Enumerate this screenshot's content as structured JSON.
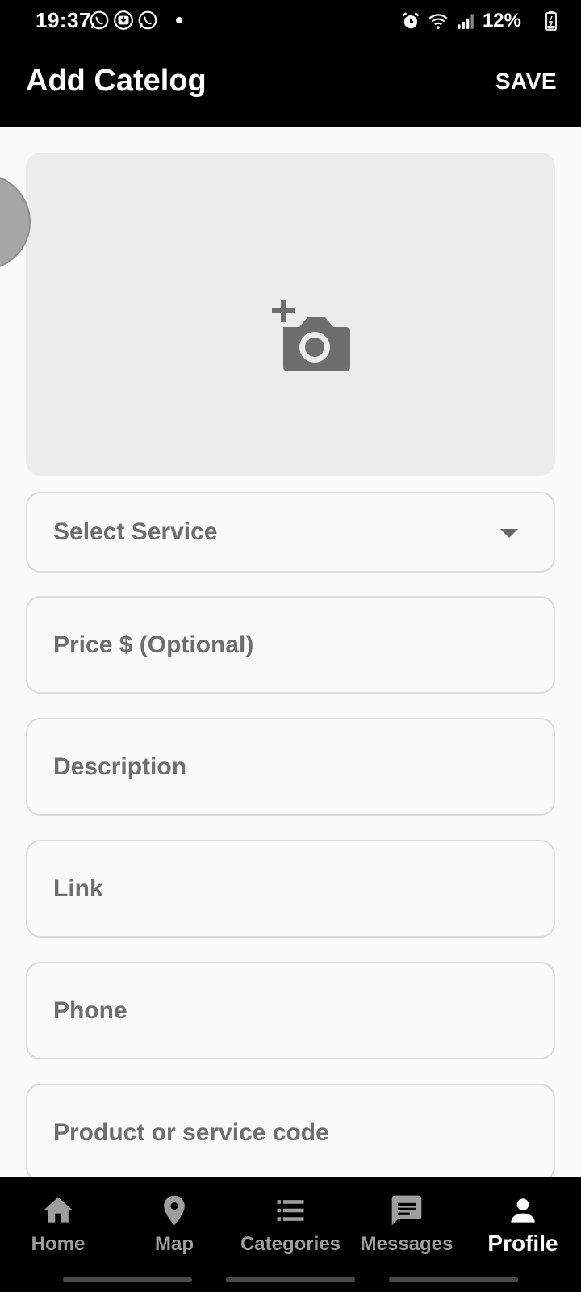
{
  "status_bar": {
    "time": "19:37",
    "battery": "12%",
    "left_icons": [
      "whatsapp-icon",
      "download-icon",
      "whatsapp-icon"
    ],
    "right_icons": [
      "alarm-icon",
      "wifi-icon",
      "signal-icon",
      "battery-icon"
    ]
  },
  "app_bar": {
    "title": "Add Catelog",
    "save_label": "SAVE"
  },
  "form": {
    "image_icon": "add-photo-icon",
    "select_service": "Select Service",
    "price": "Price $ (Optional)",
    "description": "Description",
    "link": "Link",
    "phone": "Phone",
    "code": "Product or service code"
  },
  "bottom_nav": {
    "items": [
      {
        "label": "Home",
        "icon": "home-icon"
      },
      {
        "label": "Map",
        "icon": "map-pin-icon"
      },
      {
        "label": "Categories",
        "icon": "list-icon"
      },
      {
        "label": "Messages",
        "icon": "message-icon"
      },
      {
        "label": "Profile",
        "icon": "person-icon"
      }
    ],
    "active": "Profile"
  },
  "colors": {
    "bar_background": "#000000",
    "content_background": "#fafafa",
    "image_picker_background": "#ececec",
    "field_text": "#6e6e6e",
    "nav_inactive": "#9e9e9e",
    "nav_active": "#ffffff"
  }
}
